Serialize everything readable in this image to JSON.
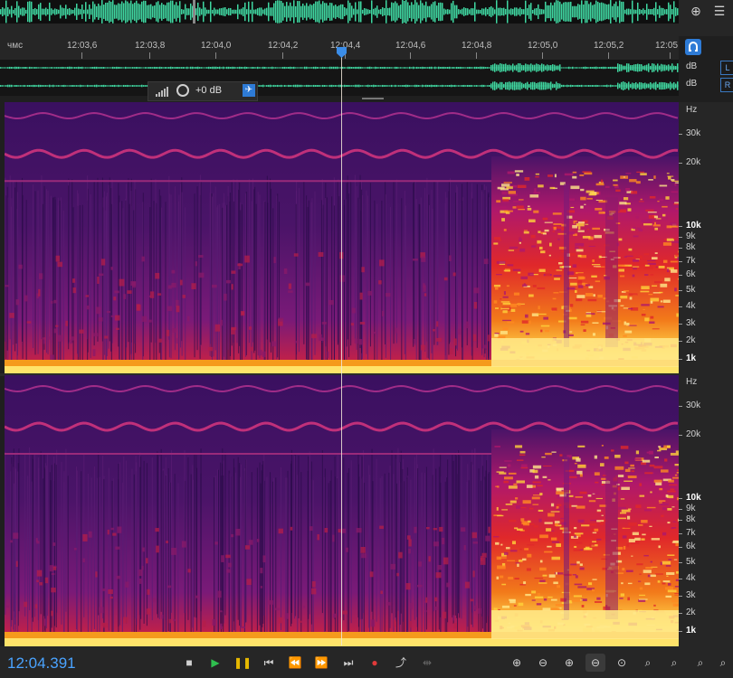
{
  "ruler": {
    "unit_label": "чмс",
    "ticks": [
      "12:03,6",
      "12:03,8",
      "12:04,0",
      "12:04,2",
      "12:04,4",
      "12:04,6",
      "12:04,8",
      "12:05,0",
      "12:05,2",
      "12:05"
    ]
  },
  "lanes": {
    "db_label_top": "dB",
    "db_label_bottom": "dB",
    "left_badge": "L",
    "right_badge": "R"
  },
  "hud": {
    "gain": "+0 dB"
  },
  "spectrogram": {
    "unit": "Hz",
    "labels": [
      "30k",
      "20k",
      "10k",
      "9k",
      "8k",
      "7k",
      "6k",
      "5k",
      "4k",
      "3k",
      "2k",
      "1k"
    ],
    "bold_labels": [
      "10k",
      "1k"
    ]
  },
  "transport": {
    "timecode": "12:04.391",
    "buttons": [
      "stop",
      "play",
      "pause",
      "go-to-start",
      "rewind",
      "fast-forward",
      "go-to-end",
      "record",
      "loop",
      "skip"
    ]
  },
  "icons": [
    "zoom-icon",
    "menu-icon",
    "snap-icon",
    "pin-icon",
    "meter-icon"
  ],
  "colors": {
    "accent": "#2e7bd6",
    "timecode": "#4aa3ff",
    "wave": "#3fd6a0"
  }
}
